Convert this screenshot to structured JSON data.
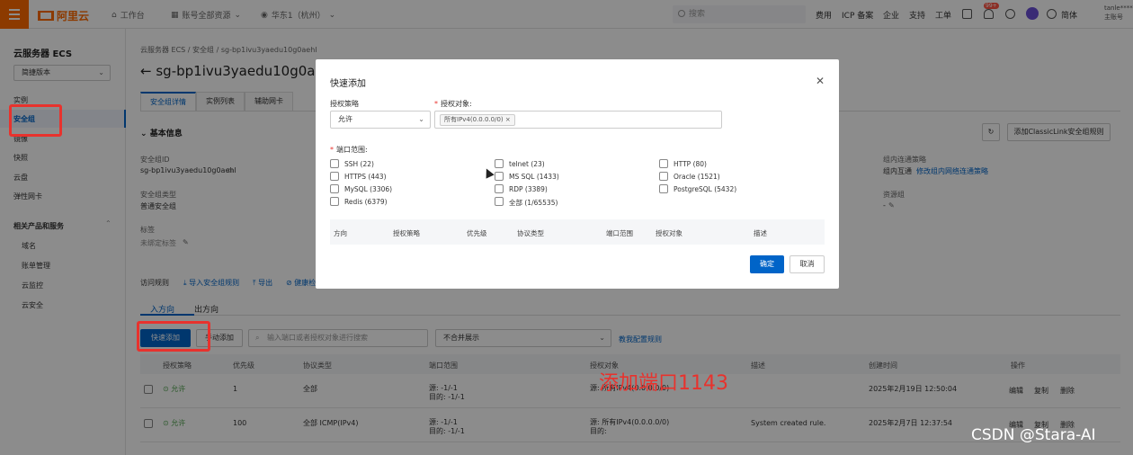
{
  "topbar": {
    "logo_text": "阿里云",
    "workspace": "工作台",
    "account": "账号全部资源",
    "region": "华东1（杭州）",
    "search_placeholder": "搜索",
    "links": [
      "费用",
      "ICP 备案",
      "企业",
      "支持",
      "工单"
    ],
    "badge": "99+",
    "lang": "简体",
    "user_line1": "tanle******@",
    "user_line2": "主账号"
  },
  "sidebar": {
    "title": "云服务器 ECS",
    "version": "简捷版本",
    "items": [
      "实例",
      "安全组",
      "镜像",
      "快照",
      "云盘",
      "弹性网卡"
    ],
    "related_title": "相关产品和服务",
    "related": [
      "域名",
      "账单管理",
      "云监控",
      "云安全"
    ]
  },
  "main": {
    "breadcrumb": "云服务器 ECS  /  安全组  /  sg-bp1ivu3yaedu10g0aehl",
    "title": "sg-bp1ivu3yaedu10g0aehl",
    "tabs": [
      "安全组详情",
      "实例列表",
      "辅助网卡"
    ],
    "basic_info": "基本信息",
    "refresh_btn": "",
    "classic_link_btn": "添加ClassicLink安全组规则",
    "fields": {
      "sg_id_label": "安全组ID",
      "sg_id": "sg-bp1ivu3yaedu10g0aehl",
      "sg_type_label": "安全组类型",
      "sg_type": "普通安全组",
      "tag_label": "标签",
      "tag_value": "未绑定标签",
      "inner_policy_label": "组内连通策略",
      "inner_policy": "组内互通",
      "inner_policy_link": "修改组内网络连通策略",
      "resource_group_label": "资源组",
      "resource_group": "-"
    },
    "access_rules": "访问规则",
    "import_link": "导入安全组规则",
    "export_link": "导出",
    "health_link": "健康检",
    "direction_tabs": [
      "入方向",
      "出方向"
    ],
    "quick_add_btn": "快速添加",
    "manual_add_btn": "手动添加",
    "search_placeholder": "输入端口或者授权对象进行搜索",
    "merge_select": "不合并展示",
    "tutorial_link": "教我配置规则",
    "table_headers": [
      "授权策略",
      "优先级",
      "协议类型",
      "端口范围",
      "授权对象",
      "描述",
      "创建时间",
      "操作"
    ],
    "rows": [
      {
        "policy": "允许",
        "priority": "1",
        "protocol": "全部",
        "port_src": "源: -1/-1",
        "port_dst": "目的: -1/-1",
        "target_src": "源: 所有IPv4(0.0.0.0/0)",
        "target_dst": "",
        "desc": "",
        "created": "2025年2月19日 12:50:04",
        "edit": "编辑",
        "copy": "复制",
        "del": "删除"
      },
      {
        "policy": "允许",
        "priority": "100",
        "protocol": "全部 ICMP(IPv4)",
        "port_src": "源: -1/-1",
        "port_dst": "目的: -1/-1",
        "target_src": "源: 所有IPv4(0.0.0.0/0)",
        "target_dst": "目的:",
        "desc": "System created rule.",
        "created": "2025年2月7日 12:37:54",
        "edit": "编辑",
        "copy": "复制",
        "del": "删除"
      }
    ],
    "annotation": "添加端口1143"
  },
  "modal": {
    "title": "快速添加",
    "policy_label": "授权策略",
    "policy_value": "允许",
    "target_label": "授权对象:",
    "target_tag": "所有IPv4(0.0.0.0/0)",
    "port_label": "端口范围:",
    "ports_col1": [
      "SSH (22)",
      "HTTPS (443)",
      "MySQL (3306)",
      "Redis (6379)"
    ],
    "ports_col2": [
      "telnet (23)",
      "MS SQL (1433)",
      "RDP (3389)",
      "全部 (1/65535)"
    ],
    "ports_col3": [
      "HTTP (80)",
      "Oracle (1521)",
      "PostgreSQL (5432)"
    ],
    "table_headers": [
      "方向",
      "授权策略",
      "优先级",
      "协议类型",
      "端口范围",
      "授权对象",
      "描述"
    ],
    "ok": "确定",
    "cancel": "取消"
  },
  "watermark": "CSDN @Stara-AI"
}
